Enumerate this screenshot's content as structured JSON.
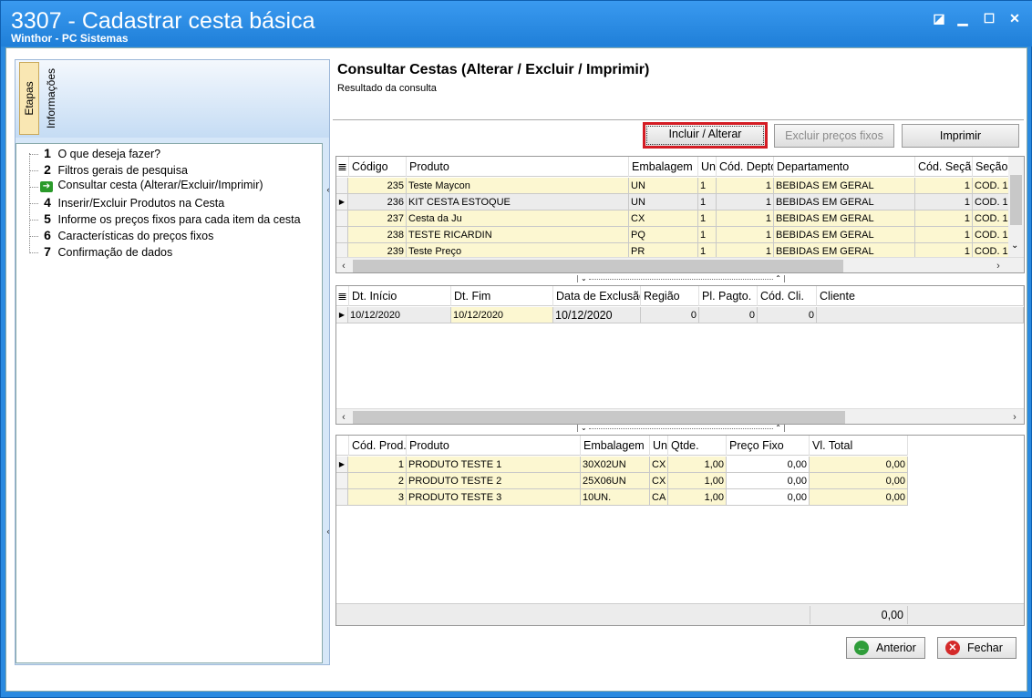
{
  "window": {
    "title": "3307 - Cadastrar cesta básica",
    "subtitle": "Winthor - PC Sistemas",
    "controls": [
      "restore-down-icon",
      "minimize-icon",
      "maximize-icon",
      "close-icon"
    ]
  },
  "sidebar": {
    "tabs": [
      {
        "label": "Etapas",
        "active": true
      },
      {
        "label": "Informações",
        "active": false
      }
    ],
    "steps": [
      {
        "num": "1",
        "label": "O que deseja fazer?"
      },
      {
        "num": "2",
        "label": "Filtros gerais de pesquisa"
      },
      {
        "num": "",
        "label": "Consultar cesta (Alterar/Excluir/Imprimir)",
        "current": true
      },
      {
        "num": "4",
        "label": "Inserir/Excluir Produtos na Cesta"
      },
      {
        "num": "5",
        "label": "Informe os preços fixos para cada item da cesta"
      },
      {
        "num": "6",
        "label": "Características do preços fixos"
      },
      {
        "num": "7",
        "label": "Confirmação de dados"
      }
    ]
  },
  "header": {
    "title": "Consultar Cestas (Alterar / Excluir / Imprimir)",
    "subtitle": "Resultado da consulta"
  },
  "toolbar": {
    "include_label": "Incluir / Alterar",
    "exclude_label": "Excluir preços fixos",
    "print_label": "Imprimir"
  },
  "baskets_grid": {
    "columns": [
      "Código",
      "Produto",
      "Embalagem",
      "Un",
      "Cód. Depto",
      "Departamento",
      "Cód. Seção",
      "Seção"
    ],
    "rows": [
      {
        "codigo": "235",
        "produto": "Teste Maycon",
        "embalagem": "UN",
        "un": "1",
        "cod_depto": "1",
        "departamento": "BEBIDAS EM GERAL",
        "cod_secao": "1",
        "secao": "COD. 1"
      },
      {
        "codigo": "236",
        "produto": "KIT CESTA ESTOQUE",
        "embalagem": "UN",
        "un": "1",
        "cod_depto": "1",
        "departamento": "BEBIDAS EM GERAL",
        "cod_secao": "1",
        "secao": "COD. 1"
      },
      {
        "codigo": "237",
        "produto": "Cesta da Ju",
        "embalagem": "CX",
        "un": "1",
        "cod_depto": "1",
        "departamento": "BEBIDAS EM GERAL",
        "cod_secao": "1",
        "secao": "COD. 1"
      },
      {
        "codigo": "238",
        "produto": "TESTE RICARDIN",
        "embalagem": "PQ",
        "un": "1",
        "cod_depto": "1",
        "departamento": "BEBIDAS EM GERAL",
        "cod_secao": "1",
        "secao": "COD. 1"
      },
      {
        "codigo": "239",
        "produto": "Teste Preço",
        "embalagem": "PR",
        "un": "1",
        "cod_depto": "1",
        "departamento": "BEBIDAS EM GERAL",
        "cod_secao": "1",
        "secao": "COD. 1"
      }
    ]
  },
  "period_grid": {
    "columns": [
      "Dt. Início",
      "Dt. Fim",
      "Data de Exclusão",
      "Região",
      "Pl. Pagto.",
      "Cód. Cli.",
      "Cliente"
    ],
    "rows": [
      {
        "dt_inicio": "10/12/2020",
        "dt_fim": "10/12/2020",
        "data_exclusao": "10/12/2020",
        "regiao": "0",
        "pl_pagto": "0",
        "cod_cli": "0",
        "cliente": ""
      }
    ]
  },
  "items_grid": {
    "columns": [
      "Cód. Prod.",
      "Produto",
      "Embalagem",
      "Un",
      "Qtde.",
      "Preço Fixo",
      "Vl. Total"
    ],
    "rows": [
      {
        "cod_prod": "1",
        "produto": "PRODUTO TESTE 1",
        "embalagem": "30X02UN",
        "un": "CX",
        "qtde": "1,00",
        "preco_fixo": "0,00",
        "vl_total": "0,00"
      },
      {
        "cod_prod": "2",
        "produto": "PRODUTO TESTE 2",
        "embalagem": "25X06UN",
        "un": "CX",
        "qtde": "1,00",
        "preco_fixo": "0,00",
        "vl_total": "0,00"
      },
      {
        "cod_prod": "3",
        "produto": "PRODUTO TESTE 3",
        "embalagem": "10UN.",
        "un": "CA",
        "qtde": "1,00",
        "preco_fixo": "0,00",
        "vl_total": "0,00"
      }
    ],
    "footer_total": "0,00"
  },
  "footer": {
    "back_label": "Anterior",
    "close_label": "Fechar"
  }
}
